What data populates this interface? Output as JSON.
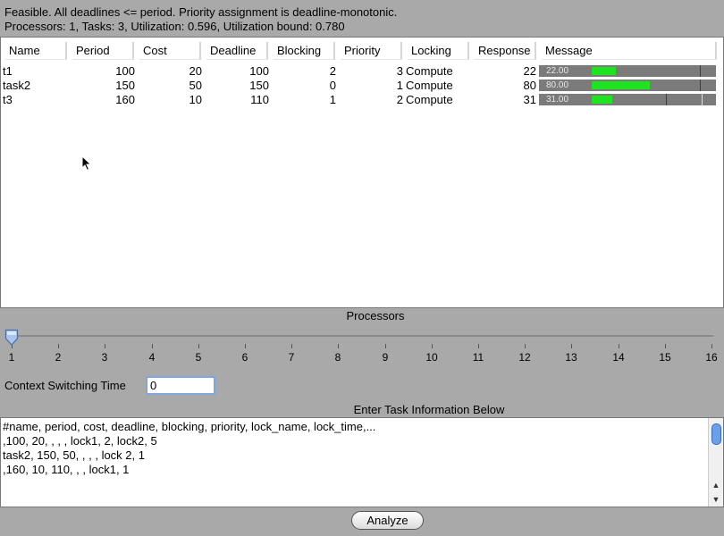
{
  "status": {
    "line1": "Feasible. All deadlines <= period. Priority assignment is deadline-monotonic.",
    "line2": "Processors: 1, Tasks: 3, Utilization: 0.596, Utilization bound: 0.780"
  },
  "table": {
    "columns": [
      "Name",
      "Period",
      "Cost",
      "Deadline",
      "Blocking",
      "Priority",
      "Locking",
      "Response",
      "Message"
    ],
    "rows": [
      {
        "name": "t1",
        "period": "100",
        "cost": "20",
        "deadline": "100",
        "blocking": "2",
        "priority": "3",
        "locking": "Compute",
        "response": "22",
        "bar_label": "22.00",
        "fraction": 0.22,
        "deadline_fraction": 1.0
      },
      {
        "name": "task2",
        "period": "150",
        "cost": "50",
        "deadline": "150",
        "blocking": "0",
        "priority": "1",
        "locking": "Compute",
        "response": "80",
        "bar_label": "80.00",
        "fraction": 0.5333,
        "deadline_fraction": 1.0
      },
      {
        "name": "t3",
        "period": "160",
        "cost": "10",
        "deadline": "110",
        "blocking": "1",
        "priority": "2",
        "locking": "Compute",
        "response": "31",
        "bar_label": "31.00",
        "fraction": 0.1938,
        "deadline_fraction": 0.6875
      }
    ],
    "colors": {
      "fill": "#1fe31f",
      "deadline_mark": "#d00000",
      "period_mark": "#dddddd",
      "bar_bg": "#7b7b7b"
    }
  },
  "processors": {
    "label": "Processors",
    "min": 1,
    "max": 16,
    "value": 1,
    "ticks": [
      "1",
      "2",
      "3",
      "4",
      "5",
      "6",
      "7",
      "8",
      "9",
      "10",
      "11",
      "12",
      "13",
      "14",
      "15",
      "16"
    ]
  },
  "context": {
    "label": "Context Switching Time",
    "value": "0"
  },
  "tasks": {
    "label": "Enter Task Information Below",
    "lines": [
      "#name, period, cost, deadline, blocking, priority, lock_name, lock_time,...",
      ",100, 20, , , , lock1, 2, lock2, 5",
      "task2, 150, 50, , , , lock 2, 1",
      ",160, 10, 110, , , lock1, 1"
    ]
  },
  "analyze_label": "Analyze",
  "icons": {
    "cursor": "arrow-cursor-icon",
    "thumb": "slider-thumb-icon",
    "scroll_up": "scroll-up-icon",
    "scroll_down": "scroll-down-icon"
  }
}
